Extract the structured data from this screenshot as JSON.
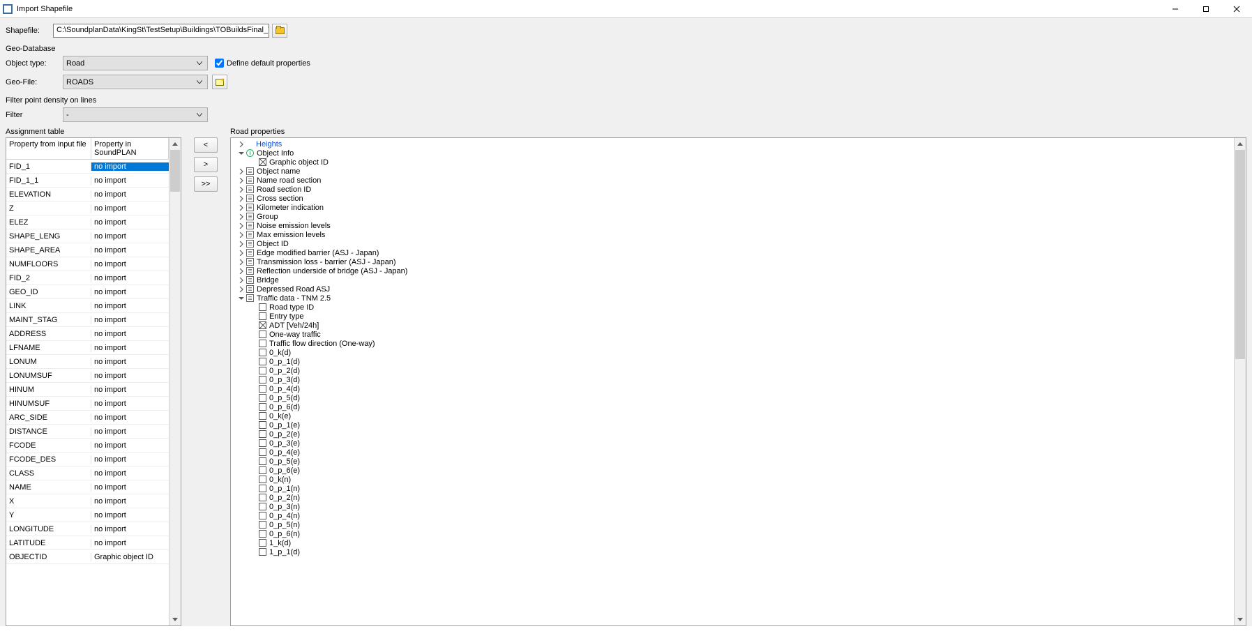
{
  "window": {
    "title": "Import Shapefile"
  },
  "shapefile": {
    "label": "Shapefile:",
    "path": "C:\\SoundplanData\\KingSt\\TestSetup\\Buildings\\TOBuildsFinal_TrafficNoise.shp"
  },
  "geodb": {
    "heading": "Geo-Database",
    "object_type_label": "Object type:",
    "object_type_value": "Road",
    "define_defaults_label": "Define default properties",
    "define_defaults_checked": true,
    "geofile_label": "Geo-File:",
    "geofile_value": "ROADS"
  },
  "filter": {
    "heading": "Filter point density on lines",
    "label": "Filter",
    "value": "-"
  },
  "assignment": {
    "title": "Assignment table",
    "col1": "Property from input file",
    "col2": "Property in SoundPLAN",
    "rows": [
      {
        "src": "FID_1",
        "dst": "no import",
        "selected": true
      },
      {
        "src": "FID_1_1",
        "dst": "no import"
      },
      {
        "src": "ELEVATION",
        "dst": "no import"
      },
      {
        "src": "Z",
        "dst": "no import"
      },
      {
        "src": "ELEZ",
        "dst": "no import"
      },
      {
        "src": "SHAPE_LENG",
        "dst": "no import"
      },
      {
        "src": "SHAPE_AREA",
        "dst": "no import"
      },
      {
        "src": "NUMFLOORS",
        "dst": "no import"
      },
      {
        "src": "FID_2",
        "dst": "no import"
      },
      {
        "src": "GEO_ID",
        "dst": "no import"
      },
      {
        "src": "LINK",
        "dst": "no import"
      },
      {
        "src": "MAINT_STAG",
        "dst": "no import"
      },
      {
        "src": "ADDRESS",
        "dst": "no import"
      },
      {
        "src": "LFNAME",
        "dst": "no import"
      },
      {
        "src": "LONUM",
        "dst": "no import"
      },
      {
        "src": "LONUMSUF",
        "dst": "no import"
      },
      {
        "src": "HINUM",
        "dst": "no import"
      },
      {
        "src": "HINUMSUF",
        "dst": "no import"
      },
      {
        "src": "ARC_SIDE",
        "dst": "no import"
      },
      {
        "src": "DISTANCE",
        "dst": "no import"
      },
      {
        "src": "FCODE",
        "dst": "no import"
      },
      {
        "src": "FCODE_DES",
        "dst": "no import"
      },
      {
        "src": "CLASS",
        "dst": "no import"
      },
      {
        "src": "NAME",
        "dst": "no import"
      },
      {
        "src": "X",
        "dst": "no import"
      },
      {
        "src": "Y",
        "dst": "no import"
      },
      {
        "src": "LONGITUDE",
        "dst": "no import"
      },
      {
        "src": "LATITUDE",
        "dst": "no import"
      },
      {
        "src": "OBJECTID",
        "dst": "Graphic object ID"
      }
    ]
  },
  "mid_buttons": {
    "left": "<",
    "right": ">",
    "all": ">>"
  },
  "tree": {
    "title": "Road properties",
    "nodes": [
      {
        "depth": 0,
        "exp": "right",
        "ico": "",
        "label": "Heights",
        "hl": true
      },
      {
        "depth": 0,
        "exp": "down",
        "ico": "info",
        "label": "Object Info"
      },
      {
        "depth": 1,
        "exp": "",
        "ico": "boxx",
        "label": "Graphic object ID"
      },
      {
        "depth": 0,
        "exp": "right",
        "ico": "doc",
        "label": "Object name"
      },
      {
        "depth": 0,
        "exp": "right",
        "ico": "doc",
        "label": "Name road section"
      },
      {
        "depth": 0,
        "exp": "right",
        "ico": "doc",
        "label": "Road section ID"
      },
      {
        "depth": 0,
        "exp": "right",
        "ico": "doc",
        "label": "Cross section"
      },
      {
        "depth": 0,
        "exp": "right",
        "ico": "doc",
        "label": "Kilometer indication"
      },
      {
        "depth": 0,
        "exp": "right",
        "ico": "doc",
        "label": "Group"
      },
      {
        "depth": 0,
        "exp": "right",
        "ico": "doc",
        "label": "Noise emission levels"
      },
      {
        "depth": 0,
        "exp": "right",
        "ico": "doc",
        "label": "Max emission levels"
      },
      {
        "depth": 0,
        "exp": "right",
        "ico": "doc",
        "label": "Object ID"
      },
      {
        "depth": 0,
        "exp": "right",
        "ico": "doc",
        "label": "Edge modified barrier (ASJ - Japan)"
      },
      {
        "depth": 0,
        "exp": "right",
        "ico": "doc",
        "label": "Transmission loss - barrier (ASJ - Japan)"
      },
      {
        "depth": 0,
        "exp": "right",
        "ico": "doc",
        "label": "Reflection underside of bridge (ASJ - Japan)"
      },
      {
        "depth": 0,
        "exp": "right",
        "ico": "doc",
        "label": "Bridge"
      },
      {
        "depth": 0,
        "exp": "right",
        "ico": "doc",
        "label": "Depressed Road ASJ"
      },
      {
        "depth": 0,
        "exp": "down",
        "ico": "doc",
        "label": "Traffic data - TNM 2.5"
      },
      {
        "depth": 1,
        "exp": "",
        "ico": "box",
        "label": "Road type ID"
      },
      {
        "depth": 1,
        "exp": "",
        "ico": "box",
        "label": "Entry type"
      },
      {
        "depth": 1,
        "exp": "",
        "ico": "boxx",
        "label": "ADT  [Veh/24h]"
      },
      {
        "depth": 1,
        "exp": "",
        "ico": "box",
        "label": "One-way traffic"
      },
      {
        "depth": 1,
        "exp": "",
        "ico": "box",
        "label": "Traffic flow direction (One-way)"
      },
      {
        "depth": 1,
        "exp": "",
        "ico": "box",
        "label": "0_k(d)"
      },
      {
        "depth": 1,
        "exp": "",
        "ico": "box",
        "label": "0_p_1(d)"
      },
      {
        "depth": 1,
        "exp": "",
        "ico": "box",
        "label": "0_p_2(d)"
      },
      {
        "depth": 1,
        "exp": "",
        "ico": "box",
        "label": "0_p_3(d)"
      },
      {
        "depth": 1,
        "exp": "",
        "ico": "box",
        "label": "0_p_4(d)"
      },
      {
        "depth": 1,
        "exp": "",
        "ico": "box",
        "label": "0_p_5(d)"
      },
      {
        "depth": 1,
        "exp": "",
        "ico": "box",
        "label": "0_p_6(d)"
      },
      {
        "depth": 1,
        "exp": "",
        "ico": "box",
        "label": "0_k(e)"
      },
      {
        "depth": 1,
        "exp": "",
        "ico": "box",
        "label": "0_p_1(e)"
      },
      {
        "depth": 1,
        "exp": "",
        "ico": "box",
        "label": "0_p_2(e)"
      },
      {
        "depth": 1,
        "exp": "",
        "ico": "box",
        "label": "0_p_3(e)"
      },
      {
        "depth": 1,
        "exp": "",
        "ico": "box",
        "label": "0_p_4(e)"
      },
      {
        "depth": 1,
        "exp": "",
        "ico": "box",
        "label": "0_p_5(e)"
      },
      {
        "depth": 1,
        "exp": "",
        "ico": "box",
        "label": "0_p_6(e)"
      },
      {
        "depth": 1,
        "exp": "",
        "ico": "box",
        "label": "0_k(n)"
      },
      {
        "depth": 1,
        "exp": "",
        "ico": "box",
        "label": "0_p_1(n)"
      },
      {
        "depth": 1,
        "exp": "",
        "ico": "box",
        "label": "0_p_2(n)"
      },
      {
        "depth": 1,
        "exp": "",
        "ico": "box",
        "label": "0_p_3(n)"
      },
      {
        "depth": 1,
        "exp": "",
        "ico": "box",
        "label": "0_p_4(n)"
      },
      {
        "depth": 1,
        "exp": "",
        "ico": "box",
        "label": "0_p_5(n)"
      },
      {
        "depth": 1,
        "exp": "",
        "ico": "box",
        "label": "0_p_6(n)"
      },
      {
        "depth": 1,
        "exp": "",
        "ico": "box",
        "label": "1_k(d)"
      },
      {
        "depth": 1,
        "exp": "",
        "ico": "box",
        "label": "1_p_1(d)"
      }
    ]
  }
}
